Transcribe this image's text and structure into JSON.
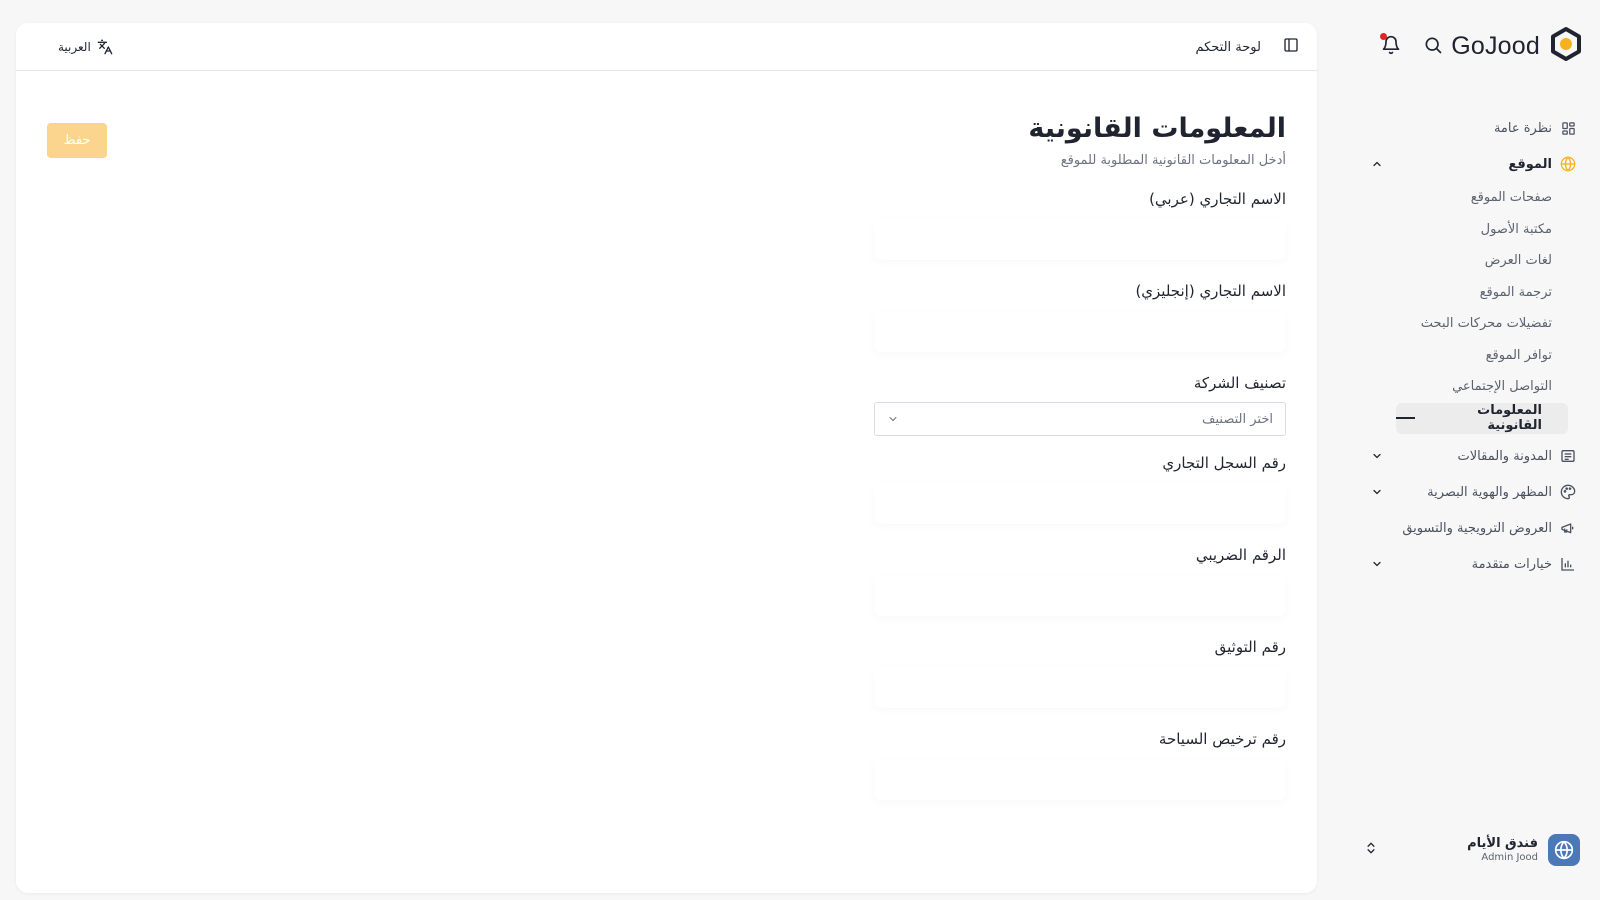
{
  "brand": {
    "name": "GoJood",
    "accent": "#f5b220",
    "dark": "#1f2430"
  },
  "header": {
    "breadcrumb": "لوحة التحكم",
    "language": "العربية"
  },
  "sidebar": {
    "items": [
      {
        "label": "نظرة عامة",
        "icon": "grid-icon"
      },
      {
        "label": "الموقع",
        "icon": "globe-icon",
        "expanded": true
      },
      {
        "label": "المدونة والمقالات",
        "icon": "newspaper-icon"
      },
      {
        "label": "المظهر والهوية البصرية",
        "icon": "palette-icon"
      },
      {
        "label": "العروض الترويجية والتسويق",
        "icon": "megaphone-icon"
      },
      {
        "label": "خيارات متقدمة",
        "icon": "chart-icon"
      }
    ],
    "sub_items": [
      "صفحات الموقع",
      "مكتبة الأصول",
      "لغات العرض",
      "ترجمة الموقع",
      "تفضيلات محركات البحث",
      "توافر الموقع",
      "التواصل الإجتماعي",
      "المعلومات القانونية"
    ],
    "active_sub": "المعلومات القانونية"
  },
  "profile": {
    "name": "فندق الأيام",
    "subtitle": "Admin Jood"
  },
  "page": {
    "title": "المعلومات القانونية",
    "subtitle": "أدخل المعلومات القانونية المطلوبة للموقع",
    "save_label": "حفظ",
    "save_color": "#fbd58e",
    "fields": [
      {
        "label": "الاسم التجاري (عربي)",
        "value": ""
      },
      {
        "label": "الاسم التجاري (إنجليزي)",
        "value": ""
      },
      {
        "label": "تصنيف الشركة",
        "placeholder": "اختر التصنيف"
      },
      {
        "label": "رقم السجل التجاري",
        "value": ""
      },
      {
        "label": "الرقم الضريبي",
        "value": ""
      },
      {
        "label": "رقم التوثيق",
        "value": ""
      },
      {
        "label": "رقم ترخيص السياحة",
        "value": ""
      }
    ]
  }
}
